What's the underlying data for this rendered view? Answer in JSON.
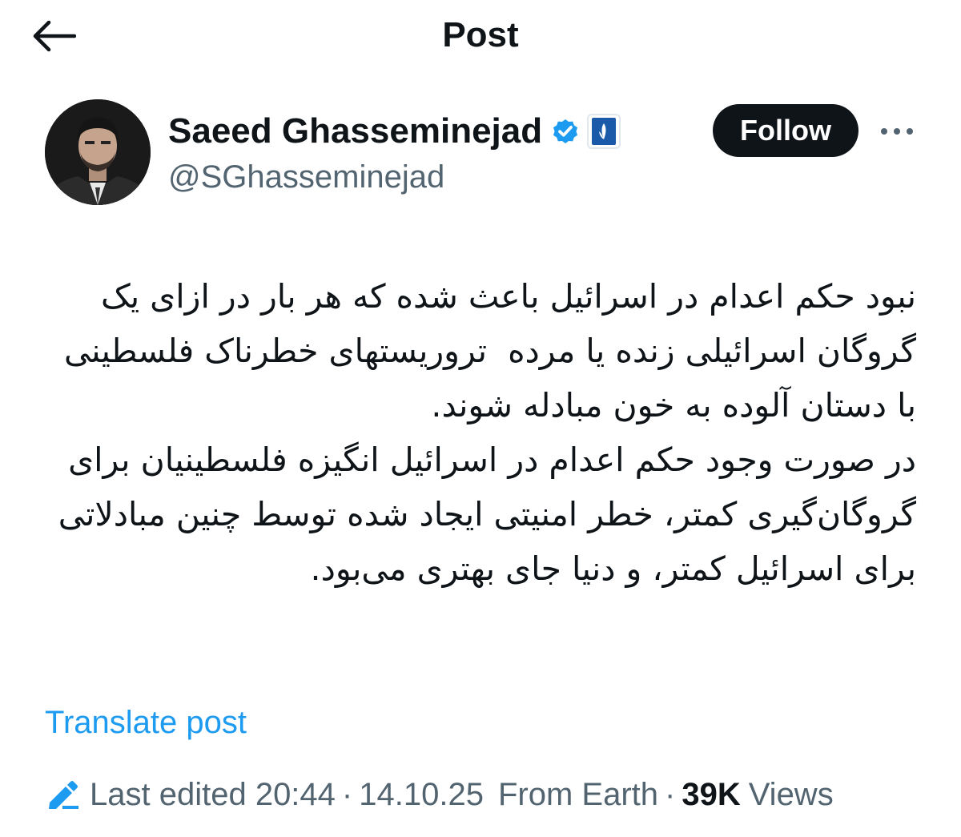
{
  "header": {
    "title": "Post",
    "back_icon": "arrow-left-icon"
  },
  "author": {
    "display_name": "Saeed Ghasseminejad",
    "handle": "@SGhasseminejad",
    "verified_icon": "verified-badge-icon",
    "affiliation_icon": "affiliation-badge-icon",
    "verified_color": "#1d9bf0",
    "affiliation_color": "#1a5aa8",
    "follow_label": "Follow",
    "more_icon": "more-horizontal-icon"
  },
  "post": {
    "text": "نبود حکم اعدام در اسرائیل باعث شده که هر بار در ازای یک گروگان اسرائیلی زنده یا مرده  تروریستهای خطرناک فلسطینی با دستان آلوده به خون مبادله شوند.\nدر صورت وجود حکم اعدام در اسرائیل انگیزه فلسطینیان برای گروگان‌گیری کمتر، خطر امنیتی ایجاد شده توسط چنین مبادلاتی برای اسرائیل کمتر، و دنیا جای بهتری می‌بود.",
    "translate_label": "Translate post"
  },
  "meta": {
    "edit_icon": "pencil-edit-icon",
    "edited_label": "Last edited 20:44",
    "separator": "·",
    "date": "14.10.25",
    "location": "From Earth",
    "views_count": "39K",
    "views_label": "Views"
  },
  "colors": {
    "text_primary": "#0f1419",
    "text_secondary": "#536471",
    "link": "#1d9bf0",
    "follow_bg": "#0f1419"
  }
}
